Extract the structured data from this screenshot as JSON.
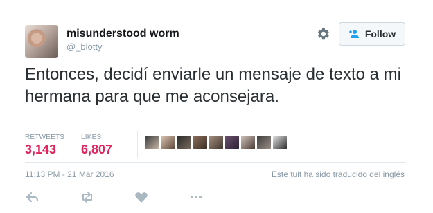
{
  "user": {
    "display_name": "misunderstood worm",
    "handle": "@_blotty"
  },
  "header": {
    "settings_icon": "gear-icon",
    "follow_label": "Follow",
    "follow_icon": "add-user-icon"
  },
  "tweet": {
    "text": "Entonces, decidí enviarle un mensaje de texto a mi hermana para que me aconsejara."
  },
  "stats": {
    "retweets_label": "RETWEETS",
    "retweets_value": "3,143",
    "likes_label": "LIKES",
    "likes_value": "6,807",
    "liker_avatar_count": 9
  },
  "meta": {
    "timestamp": "11:13 PM - 21 Mar 2016",
    "translation_note": "Este tuit ha sido traducido del inglés"
  },
  "actions": [
    {
      "icon": "reply-icon"
    },
    {
      "icon": "retweet-icon"
    },
    {
      "icon": "heart-icon"
    },
    {
      "icon": "more-icon"
    }
  ],
  "colors": {
    "stat_value": "#e0245e",
    "muted": "#8899a6",
    "text": "#292f33"
  }
}
